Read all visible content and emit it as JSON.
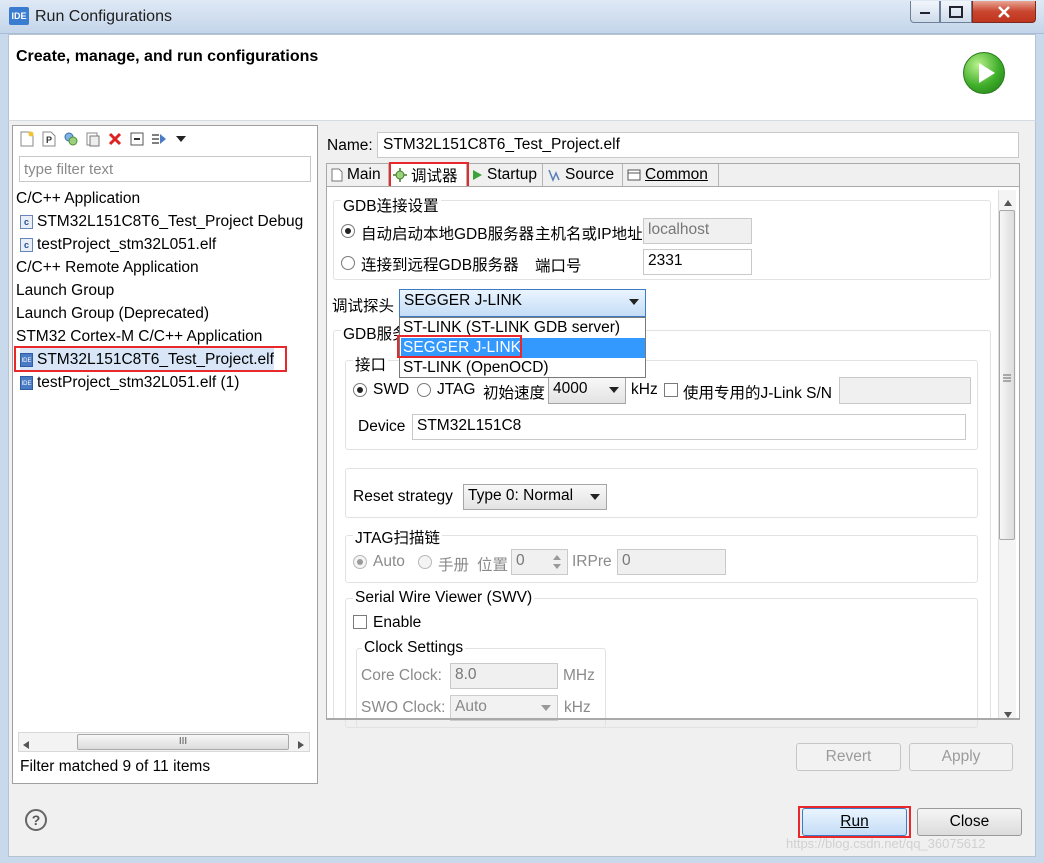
{
  "window": {
    "app_icon": "IDE",
    "title": "Run Configurations",
    "minimize": "minimize-icon",
    "maximize": "maximize-icon",
    "close": "close-icon"
  },
  "header": {
    "title": "Create, manage, and run configurations",
    "icon": "run-icon"
  },
  "sidebar": {
    "toolbar_icons": [
      "new-config-icon",
      "new-prototype-icon",
      "duplicate-icon",
      "export-icon",
      "delete-icon",
      "collapse-all-icon",
      "filter-icon",
      "view-menu-icon"
    ],
    "filter_placeholder": "type filter text",
    "tree": [
      {
        "label": "C/C++ Application",
        "icon": "",
        "indent": 0
      },
      {
        "label": "STM32L151C8T6_Test_Project Debug",
        "icon": "c",
        "indent": 1
      },
      {
        "label": "testProject_stm32L051.elf",
        "icon": "c",
        "indent": 1
      },
      {
        "label": "C/C++ Remote Application",
        "icon": "",
        "indent": 0
      },
      {
        "label": "Launch Group",
        "icon": "",
        "indent": 0
      },
      {
        "label": "Launch Group (Deprecated)",
        "icon": "",
        "indent": 0
      },
      {
        "label": "STM32 Cortex-M C/C++ Application",
        "icon": "",
        "indent": 0
      },
      {
        "label": "STM32L151C8T6_Test_Project.elf",
        "icon": "ide",
        "indent": 1,
        "selected": true
      },
      {
        "label": "testProject_stm32L051.elf (1)",
        "icon": "ide",
        "indent": 1
      }
    ],
    "scroll_label": "III",
    "filter_status": "Filter matched 9 of 11 items"
  },
  "main": {
    "name_label": "Name:",
    "name_value": "STM32L151C8T6_Test_Project.elf",
    "tabs": [
      {
        "label": "Main",
        "icon": "main-tab-icon"
      },
      {
        "label": "调试器",
        "icon": "debugger-tab-icon",
        "active": true
      },
      {
        "label": "Startup",
        "icon": "startup-tab-icon"
      },
      {
        "label": "Source",
        "icon": "source-tab-icon"
      },
      {
        "label": "Common",
        "icon": "common-tab-icon"
      }
    ],
    "gdb_connection": {
      "title": "GDB连接设置",
      "auto_local": "自动启动本地GDB服务器",
      "host_label": "主机名或IP地址",
      "host_value": "localhost",
      "remote": "连接到远程GDB服务器",
      "port_label": "端口号",
      "port_value": "2331"
    },
    "probe": {
      "label": "调试探头",
      "selected": "SEGGER J-LINK",
      "options": [
        "ST-LINK (ST-LINK GDB server)",
        "SEGGER J-LINK",
        "ST-LINK (OpenOCD)"
      ]
    },
    "gdb_server": {
      "title": "GDB服务",
      "interface_title": "接口",
      "swd": "SWD",
      "jtag": "JTAG",
      "speed_label": "初始速度",
      "speed_value": "4000",
      "speed_unit": "kHz",
      "jlink_sn_label": "使用专用的J-Link S/N",
      "device_label": "Device",
      "device_value": "STM32L151C8"
    },
    "reset": {
      "label": "Reset strategy",
      "value": "Type 0: Normal"
    },
    "jtag_chain": {
      "title": "JTAG扫描链",
      "auto": "Auto",
      "manual": "手册",
      "position_label": "位置",
      "position_value": "0",
      "irpre_label": "IRPre",
      "irpre_value": "0"
    },
    "swv": {
      "title": "Serial Wire Viewer (SWV)",
      "enable": "Enable",
      "clock_title": "Clock Settings",
      "core_clock_label": "Core Clock:",
      "core_clock_value": "8.0",
      "core_clock_unit": "MHz",
      "swo_clock_label": "SWO Clock:",
      "swo_clock_value": "Auto",
      "swo_clock_unit": "kHz"
    },
    "revert": "Revert",
    "apply": "Apply"
  },
  "footer": {
    "help": "?",
    "run": "Run",
    "close": "Close",
    "watermark": "https://blog.csdn.net/qq_36075612"
  }
}
